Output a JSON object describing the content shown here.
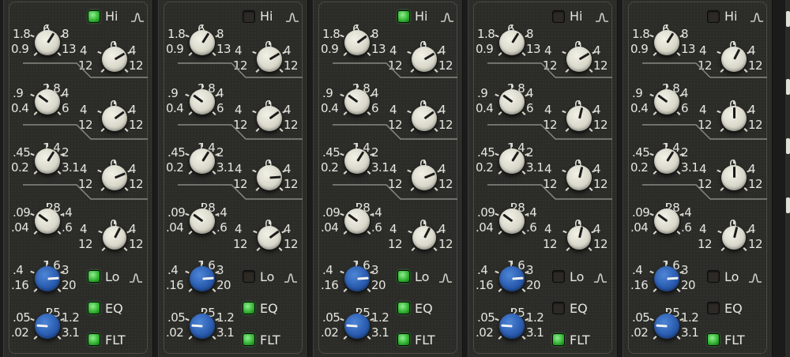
{
  "colors": {
    "panel_bg": "#2b2b28",
    "led_on": "#2fb12f",
    "led_off": "#2d2a26",
    "knob_gray": "#d9d8cb",
    "knob_blue": "#2a5cb0",
    "text": "#e6e6e0"
  },
  "icons": {
    "shape": "bell-shape-icon"
  },
  "scales": {
    "hi_freq": {
      "top": "6",
      "left_top": "1.8",
      "right_top": "8",
      "left_bottom": "0.9",
      "right_bottom": "13"
    },
    "hmid_freq": {
      "top": "2.8",
      "left_top": ".9",
      "right_top": "4",
      "left_bottom": "0.4",
      "right_bottom": "6"
    },
    "lmid_freq": {
      "top": "1.4",
      "left_top": ".45",
      "right_top": "2",
      "left_bottom": "0.2",
      "right_bottom": "3.1"
    },
    "lo_freq": {
      "top": ".28",
      "left_top": ".09",
      "right_top": ".4",
      "left_bottom": ".04",
      "right_bottom": ".6"
    },
    "gain": {
      "top": "0",
      "left_top": "4",
      "right_top": "4",
      "left_bottom": "12",
      "right_bottom": "12"
    },
    "hpf": {
      "top": "1.6",
      "left_top": ".4",
      "right_top": "3",
      "left_bottom": ".16",
      "right_bottom": "20"
    },
    "lpf": {
      "top": ".25",
      "left_top": ".05",
      "right_top": "1.2",
      "left_bottom": ".02",
      "right_bottom": "3.1"
    }
  },
  "buttons": {
    "hi": "Hi",
    "lo": "Lo",
    "eq": "EQ",
    "flt": "FLT"
  },
  "channels": [
    {
      "hi_on": true,
      "lo_on": true,
      "eq_on": true,
      "flt_on": true,
      "knobs": {
        "hi_freq": 0.62,
        "hi_gain": 0.72,
        "hmid_freq": 0.3,
        "hmid_gain": 0.7,
        "lmid_freq": 0.62,
        "lmid_gain": 0.75,
        "lo_freq": 0.3,
        "lo_gain": 0.6,
        "hpf": 0.82,
        "lpf": 0.18
      }
    },
    {
      "hi_on": false,
      "lo_on": false,
      "eq_on": true,
      "flt_on": true,
      "knobs": {
        "hi_freq": 0.62,
        "hi_gain": 0.72,
        "hmid_freq": 0.3,
        "hmid_gain": 0.7,
        "lmid_freq": 0.62,
        "lmid_gain": 0.82,
        "lo_freq": 0.3,
        "lo_gain": 0.7,
        "hpf": 0.82,
        "lpf": 0.18
      }
    },
    {
      "hi_on": true,
      "lo_on": true,
      "eq_on": true,
      "flt_on": true,
      "knobs": {
        "hi_freq": 0.7,
        "hi_gain": 0.72,
        "hmid_freq": 0.3,
        "hmid_gain": 0.7,
        "lmid_freq": 0.62,
        "lmid_gain": 0.75,
        "lo_freq": 0.3,
        "lo_gain": 0.6,
        "hpf": 0.82,
        "lpf": 0.18
      }
    },
    {
      "hi_on": false,
      "lo_on": false,
      "eq_on": false,
      "flt_on": true,
      "knobs": {
        "hi_freq": 0.62,
        "hi_gain": 0.72,
        "hmid_freq": 0.3,
        "hmid_gain": 0.55,
        "lmid_freq": 0.62,
        "lmid_gain": 0.55,
        "lo_freq": 0.3,
        "lo_gain": 0.55,
        "hpf": 0.82,
        "lpf": 0.18
      }
    },
    {
      "hi_on": false,
      "lo_on": false,
      "eq_on": false,
      "flt_on": true,
      "knobs": {
        "hi_freq": 0.62,
        "hi_gain": 0.6,
        "hmid_freq": 0.3,
        "hmid_gain": 0.5,
        "lmid_freq": 0.62,
        "lmid_gain": 0.5,
        "lo_freq": 0.3,
        "lo_gain": 0.55,
        "hpf": 0.82,
        "lpf": 0.18
      }
    }
  ]
}
